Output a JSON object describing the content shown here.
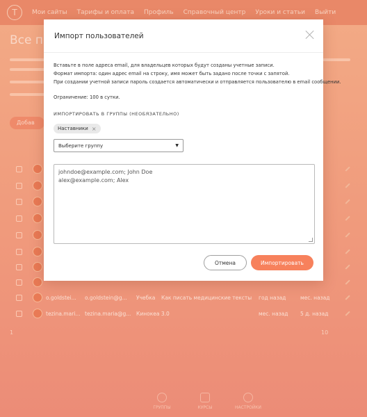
{
  "nav": {
    "items": [
      {
        "label": "Мои сайты"
      },
      {
        "label": "Тарифы и оплата"
      },
      {
        "label": "Профиль"
      },
      {
        "label": "Справочный центр"
      },
      {
        "label": "Уроки и статьи"
      },
      {
        "label": "Выйти"
      }
    ]
  },
  "page": {
    "title": "Все по",
    "add_button": "Добав",
    "pagination": {
      "current": "1",
      "total": "10"
    }
  },
  "table": {
    "rows": [
      {
        "name": "o.goldstei...",
        "email": "o.goldstein@g...",
        "group": "Учебка",
        "course": "Как писать медицинские тексты",
        "created": "год назад",
        "active": "мес. назад"
      },
      {
        "name": "tezina.mari...",
        "email": "tezina.maria@g...",
        "group": "Кинокеа 3.0",
        "course": "",
        "created": "мес. назад",
        "active": "5 д. назад"
      }
    ]
  },
  "bottom_nav": {
    "items": [
      {
        "label": "ГРУППЫ"
      },
      {
        "label": "КУРСЫ"
      },
      {
        "label": "НАСТРОЙКИ"
      }
    ]
  },
  "modal": {
    "title": "Импорт пользователей",
    "info_lines": [
      "Вставьте в поле адреса email, для владельцев которых будут созданы учетные записи.",
      "Формат импорта: один адрес email на строку, имя может быть задано после точки с запятой.",
      "При создании учетной записи пароль создается автоматически и отправляется пользователю в email сообщении."
    ],
    "limit_text": "Ограничение: 100 в сутки.",
    "group_label": "ИМПОРТИРОВАТЬ В ГРУППЫ (НЕОБЯЗАТЕЛЬНО)",
    "tag": "Наставники",
    "select_placeholder": "Выберите группу",
    "textarea_lines": [
      "johndoe@example.com; John Doe",
      "alex@example.com; Alex"
    ],
    "cancel_label": "Отмена",
    "import_label": "Импортировать"
  },
  "colors": {
    "accent": "#f7815c",
    "overlay": "#f3ab86"
  },
  "icons": [
    "logo-icon",
    "close-icon",
    "chevron-down-icon",
    "pencil-icon",
    "groups-icon",
    "courses-icon",
    "settings-icon"
  ]
}
